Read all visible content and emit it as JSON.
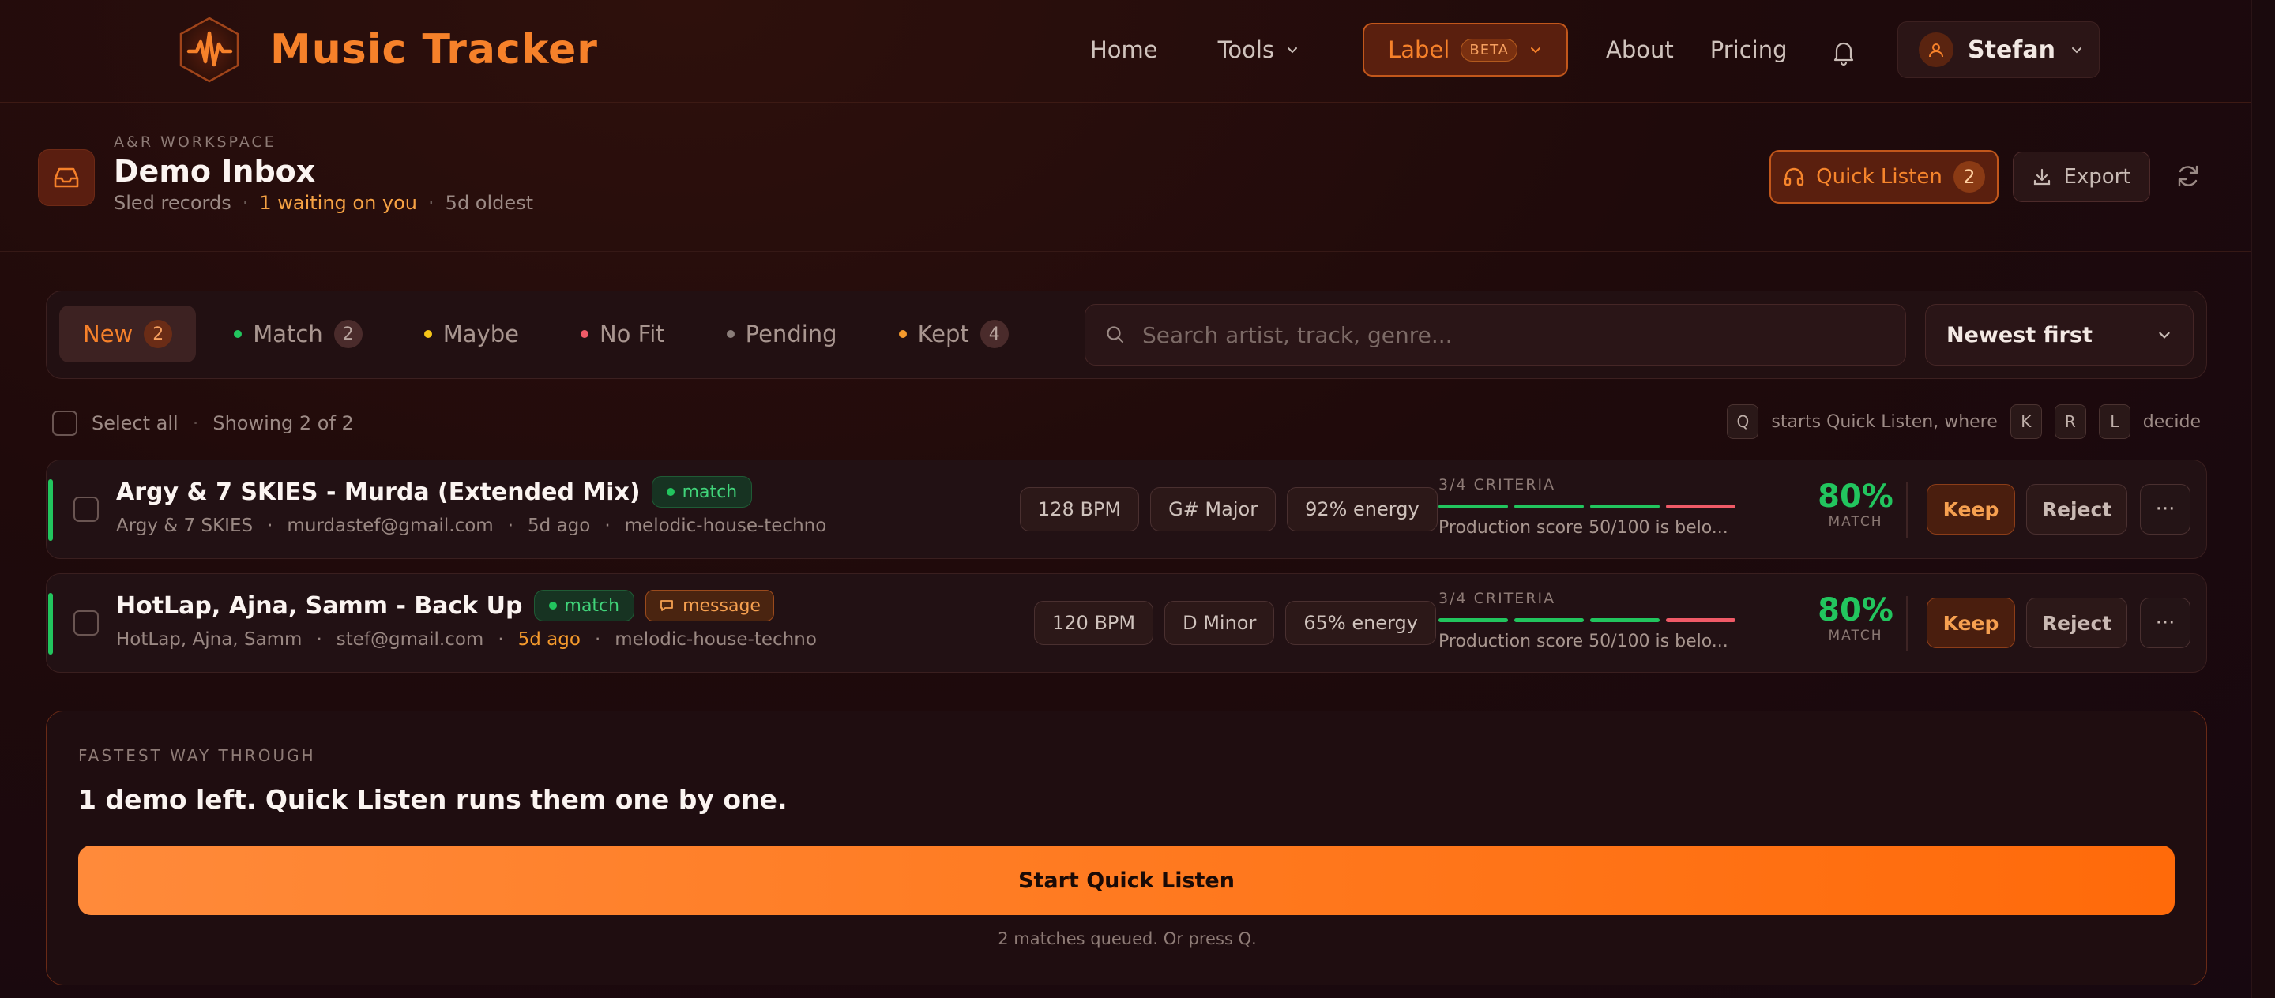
{
  "app": {
    "name": "Music Tracker"
  },
  "nav": {
    "home": "Home",
    "tools": "Tools",
    "label": "Label",
    "beta": "BETA",
    "about": "About",
    "pricing": "Pricing",
    "user": "Stefan"
  },
  "workspace": {
    "kicker": "A&R WORKSPACE",
    "title": "Demo Inbox",
    "org": "Sled records",
    "waiting": "1 waiting on you",
    "oldest": "5d oldest",
    "quick_listen": "Quick Listen",
    "quick_listen_count": "2",
    "export": "Export"
  },
  "tabs": [
    {
      "label": "New",
      "count": "2",
      "dot": null,
      "active": true
    },
    {
      "label": "Match",
      "count": "2",
      "dot": "#22c55e"
    },
    {
      "label": "Maybe",
      "count": null,
      "dot": "#f5c518"
    },
    {
      "label": "No Fit",
      "count": null,
      "dot": "#f05a67"
    },
    {
      "label": "Pending",
      "count": null,
      "dot": "#8a7d79"
    },
    {
      "label": "Kept",
      "count": "4",
      "dot": "#f59a2c"
    }
  ],
  "search": {
    "placeholder": "Search artist, track, genre..."
  },
  "sort": {
    "value": "Newest first"
  },
  "listbar": {
    "select_all": "Select all",
    "showing": "Showing 2 of 2",
    "hint_key_q": "Q",
    "hint_text": "starts Quick Listen, where",
    "hint_key_k": "K",
    "hint_key_r": "R",
    "hint_key_l": "L",
    "hint_end": "decide"
  },
  "demos": [
    {
      "title": "Argy & 7 SKIES - Murda (Extended Mix)",
      "match_tag": "match",
      "message_tag": null,
      "artist": "Argy & 7 SKIES",
      "email": "murdastef@gmail.com",
      "age": "5d ago",
      "age_highlight": false,
      "genre": "melodic-house-techno",
      "bpm": "128 BPM",
      "key": "G# Major",
      "energy": "92% energy",
      "criteria_label": "3/4 CRITERIA",
      "criteria_met": [
        true,
        true,
        true,
        false
      ],
      "criteria_note": "Production score 50/100 is belo...",
      "score": "80%",
      "score_label": "MATCH",
      "keep": "Keep",
      "reject": "Reject",
      "more": "···"
    },
    {
      "title": "HotLap, Ajna, Samm - Back Up",
      "match_tag": "match",
      "message_tag": "message",
      "artist": "HotLap, Ajna, Samm",
      "email": "stef@gmail.com",
      "age": "5d ago",
      "age_highlight": true,
      "genre": "melodic-house-techno",
      "bpm": "120 BPM",
      "key": "D Minor",
      "energy": "65% energy",
      "criteria_label": "3/4 CRITERIA",
      "criteria_met": [
        true,
        true,
        true,
        false
      ],
      "criteria_note": "Production score 50/100 is belo...",
      "score": "80%",
      "score_label": "MATCH",
      "keep": "Keep",
      "reject": "Reject",
      "more": "···"
    }
  ],
  "cta": {
    "kicker": "FASTEST WAY THROUGH",
    "headline": "1 demo left. Quick Listen runs them one by one.",
    "button": "Start Quick Listen",
    "note": "2 matches queued. Or press Q."
  },
  "colors": {
    "accent": "#f6812a",
    "match_green": "#22c55e",
    "fail_red": "#f05a67",
    "background": "#1f0a0b"
  }
}
